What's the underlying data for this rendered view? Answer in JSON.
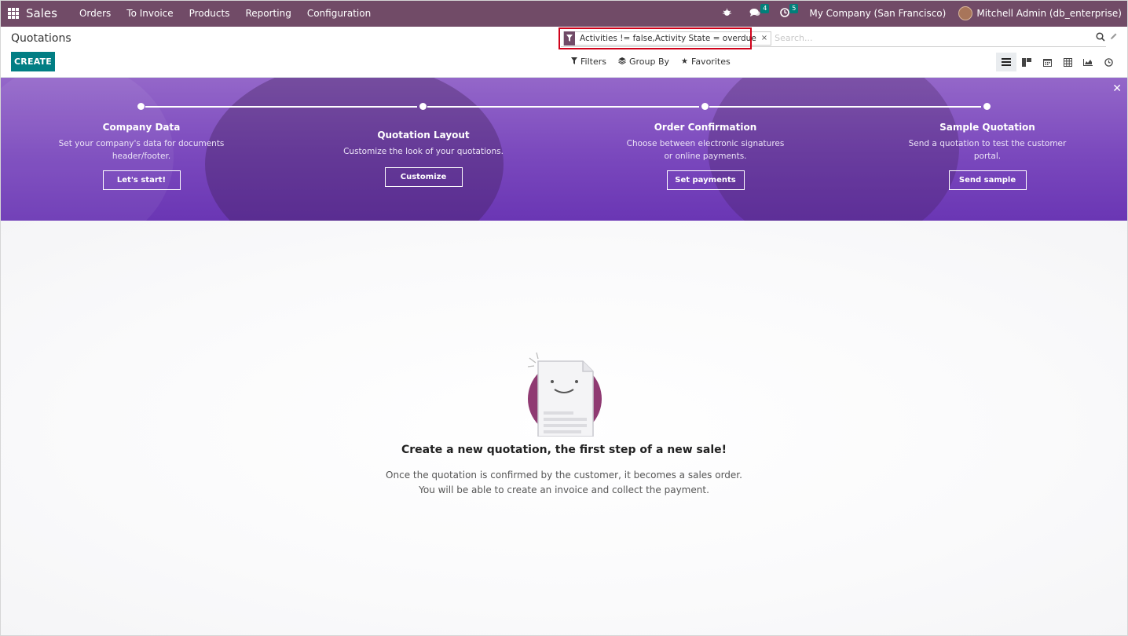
{
  "navbar": {
    "app_name": "Sales",
    "menu": [
      "Orders",
      "To Invoice",
      "Products",
      "Reporting",
      "Configuration"
    ],
    "messages_count": "4",
    "activities_count": "5",
    "company": "My Company (San Francisco)",
    "user": "Mitchell Admin (db_enterprise)"
  },
  "control_panel": {
    "title": "Quotations",
    "create_label": "CREATE",
    "facet_value": "Activities != false,Activity State = overdue",
    "search_placeholder": "Search...",
    "filters_label": "Filters",
    "groupby_label": "Group By",
    "favorites_label": "Favorites",
    "views": [
      "list-view-icon",
      "kanban-view-icon",
      "calendar-view-icon",
      "pivot-view-icon",
      "graph-view-icon",
      "activity-view-icon"
    ]
  },
  "onboarding": {
    "steps": [
      {
        "title": "Company Data",
        "desc1": "Set your company's data for documents",
        "desc2": "header/footer.",
        "button": "Let's start!"
      },
      {
        "title": "Quotation Layout",
        "desc1": "Customize the look of your quotations.",
        "desc2": "",
        "button": "Customize"
      },
      {
        "title": "Order Confirmation",
        "desc1": "Choose between electronic signatures",
        "desc2": "or online payments.",
        "button": "Set payments"
      },
      {
        "title": "Sample Quotation",
        "desc1": "Send a quotation to test the customer",
        "desc2": "portal.",
        "button": "Send sample"
      }
    ]
  },
  "empty_state": {
    "title": "Create a new quotation, the first step of a new sale!",
    "line1": "Once the quotation is confirmed by the customer, it becomes a sales order.",
    "line2": "You will be able to create an invoice and collect the payment."
  },
  "colors": {
    "navbar": "#714B67",
    "primary": "#017e84",
    "banner": "#7a48bd",
    "highlight": "#d0021b"
  }
}
